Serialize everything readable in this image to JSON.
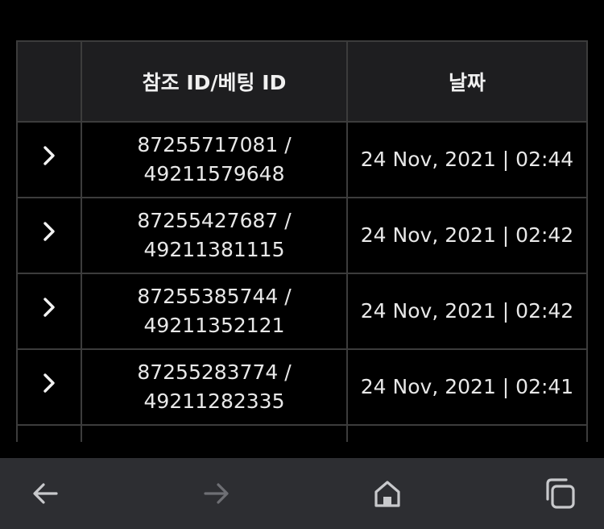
{
  "table": {
    "headers": [
      "",
      "참조 ID/베팅 ID",
      "날짜"
    ],
    "rows": [
      {
        "ids": "87255717081 /\n49211579648",
        "date": "24 Nov, 2021 | 02:44"
      },
      {
        "ids": "87255427687 /\n49211381115",
        "date": "24 Nov, 2021 | 02:42"
      },
      {
        "ids": "87255385744 /\n49211352121",
        "date": "24 Nov, 2021 | 02:42"
      },
      {
        "ids": "87255283774 /\n49211282335",
        "date": "24 Nov, 2021 | 02:41"
      }
    ]
  },
  "colors": {
    "background": "#000000",
    "header_bg": "#1e1e20",
    "border": "#3c3c3c",
    "nav_bar": "#2d2e32",
    "nav_icon_active": "#c8c9cc",
    "nav_icon_disabled": "#6e6f74"
  },
  "icons": {
    "row_expand": "chevron-right-icon",
    "back": "arrow-left-icon",
    "forward": "arrow-right-icon",
    "home": "home-icon",
    "tabs": "tabs-icon"
  }
}
